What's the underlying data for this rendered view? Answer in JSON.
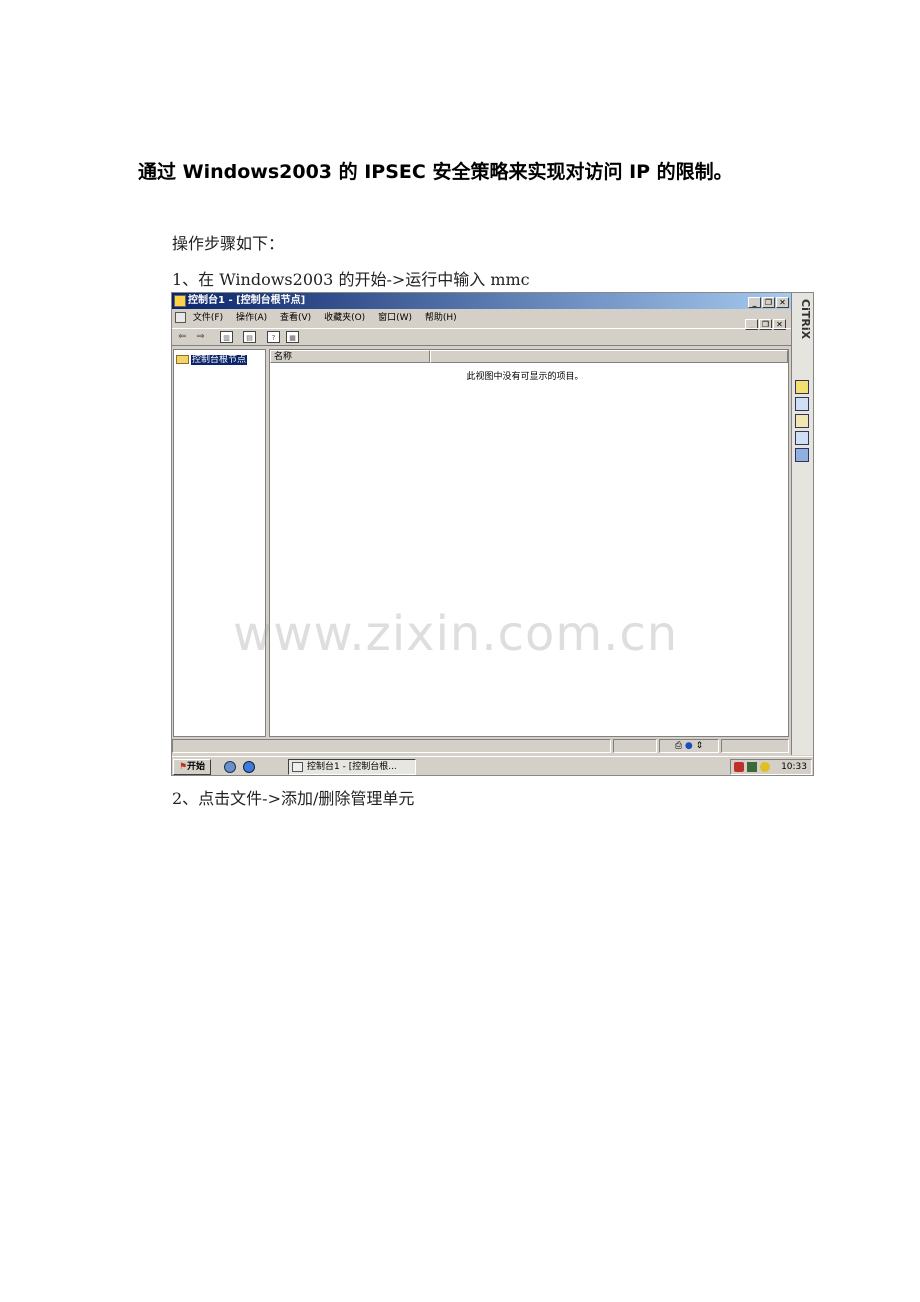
{
  "document": {
    "title": "通过 Windows2003 的 IPSEC 安全策略来实现对访问 IP 的限制。",
    "intro": "操作步骤如下：",
    "step1": "1、在 Windows2003 的开始->运行中输入 mmc",
    "step2": "2、点击文件->添加/删除管理单元",
    "watermark": "www.zixin.com.cn"
  },
  "screenshot": {
    "window_title": "控制台1 - [控制台根节点]",
    "menu": [
      "文件(F)",
      "操作(A)",
      "查看(V)",
      "收藏夹(O)",
      "窗口(W)",
      "帮助(H)"
    ],
    "tree_root": "控制台根节点",
    "list_column": "名称",
    "empty_message": "此视图中没有可显示的项目。",
    "taskbar": {
      "start_label": "开始",
      "task_label": "控制台1 - [控制台根...",
      "clock": "10:33"
    },
    "citrix_logo": "CiTRiX"
  }
}
